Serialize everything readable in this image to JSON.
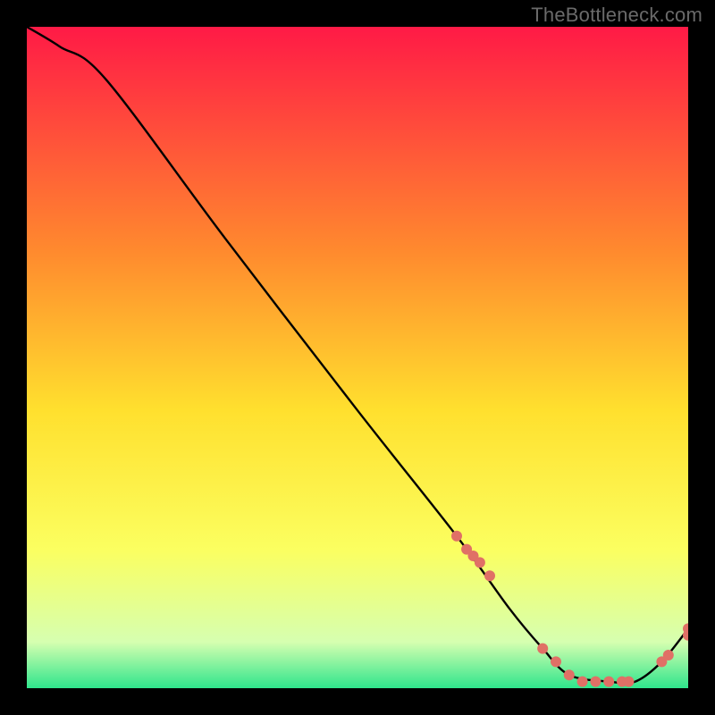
{
  "watermark": "TheBottleneck.com",
  "colors": {
    "top": "#ff1a46",
    "q1": "#ff8a2e",
    "mid": "#ffe02e",
    "q3": "#fbff60",
    "q4": "#d6ffb0",
    "bottom": "#2fe58c",
    "line": "#000000",
    "marker": "#e07066"
  },
  "chart_data": {
    "type": "line",
    "title": "",
    "xlabel": "",
    "ylabel": "",
    "xlim": [
      0,
      100
    ],
    "ylim": [
      0,
      100
    ],
    "legend": false,
    "grid": false,
    "series": [
      {
        "name": "bottleneck-curve",
        "x": [
          0,
          5,
          12,
          30,
          50,
          65,
          73,
          78,
          82,
          88,
          92,
          96,
          100
        ],
        "y": [
          100,
          97,
          92,
          68,
          42,
          23,
          12,
          6,
          2,
          1,
          1,
          4,
          9
        ]
      }
    ],
    "markers": {
      "name": "highlighted-points",
      "x": [
        65,
        66.5,
        67.5,
        68.5,
        70,
        78,
        80,
        82,
        84,
        86,
        88,
        90,
        91,
        96,
        97,
        100,
        100
      ],
      "y": [
        23,
        21,
        20,
        19,
        17,
        6,
        4,
        2,
        1,
        1,
        1,
        1,
        1,
        4,
        5,
        8,
        9
      ]
    },
    "annotations": []
  }
}
